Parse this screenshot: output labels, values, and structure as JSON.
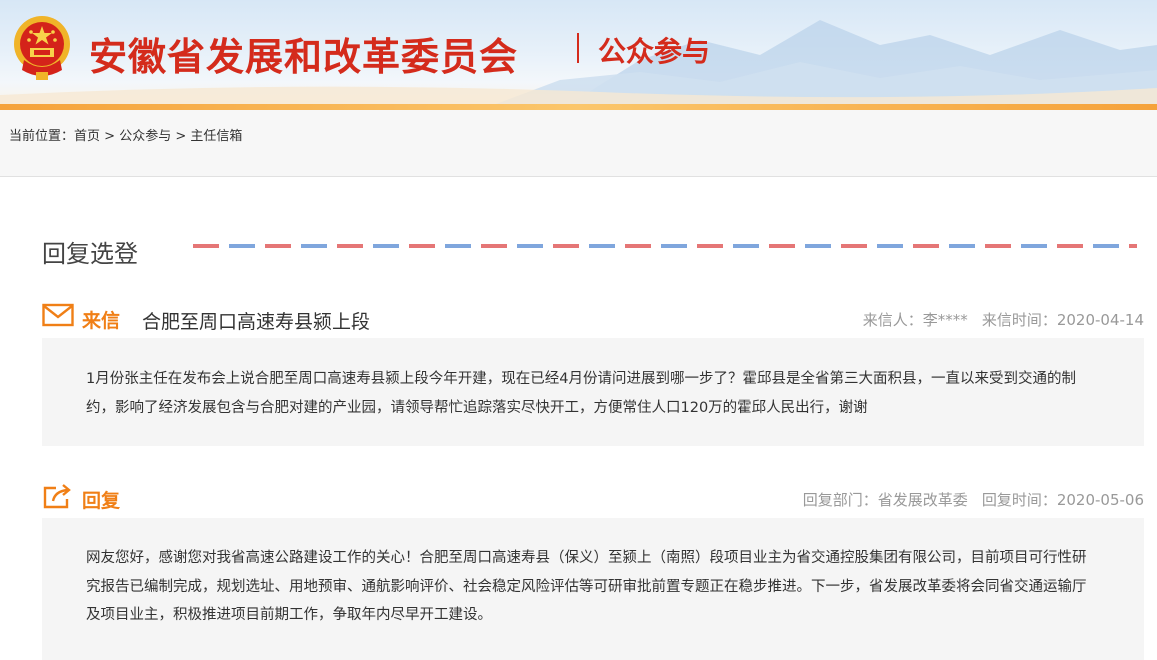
{
  "header": {
    "site_title": "安徽省发展和改革委员会",
    "section_title": "公众参与",
    "accent_color": "#d42b1c",
    "bar_color": "#f5a23a",
    "emblem_icon": "national-emblem-icon"
  },
  "breadcrumb": {
    "prefix": "当前位置：",
    "items": [
      "首页",
      "公众参与",
      "主任信箱"
    ],
    "separator": " > "
  },
  "section": {
    "title": "回复选登"
  },
  "letter": {
    "icon": "envelope-icon",
    "tag": "来信",
    "subject": "合肥至周口高速寿县颍上段",
    "sender": "来信人：李****",
    "date": "来信时间：2020-04-14",
    "body": "1月份张主任在发布会上说合肥至周口高速寿县颍上段今年开建，现在已经4月份请问进展到哪一步了？霍邱县是全省第三大面积县，一直以来受到交通的制约，影响了经济发展包含与合肥对建的产业园，请领导帮忙追踪落实尽快开工，方便常住人口120万的霍邱人民出行，谢谢"
  },
  "reply": {
    "icon": "reply-share-icon",
    "tag": "回复",
    "department": "回复部门：省发展改革委",
    "date": "回复时间：2020-05-06",
    "body": "网友您好，感谢您对我省高速公路建设工作的关心！合肥至周口高速寿县（保义）至颍上（南照）段项目业主为省交通控股集团有限公司，目前项目可行性研究报告已编制完成，规划选址、用地预审、通航影响评价、社会稳定风险评估等可研审批前置专题正在稳步推进。下一步，省发展改革委将会同省交通运输厅及项目业主，积极推进项目前期工作，争取年内尽早开工建设。"
  }
}
